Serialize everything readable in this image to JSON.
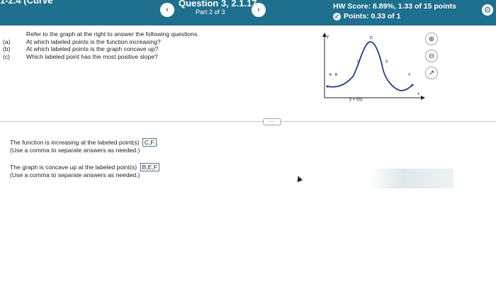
{
  "header": {
    "section_title": "1-2.4 (Curve",
    "prev_label": "‹",
    "next_label": "›",
    "question_title": "Question 3, 2.1.17",
    "question_part": "Part 2 of 3",
    "hw_score": "HW Score: 8.89%, 1.33 of 15 points",
    "points": "Points: 0.33 of 1"
  },
  "question": {
    "intro": "Refer to the graph at the right to answer the following questions.",
    "items": [
      {
        "label": "(a)",
        "text": "At which labeled points is the function increasing?"
      },
      {
        "label": "(b)",
        "text": "At which labeled points is the graph concave up?"
      },
      {
        "label": "(c)",
        "text": "Which labeled point has the most positive slope?"
      }
    ]
  },
  "graph": {
    "y_axis_label": "y",
    "x_axis_label": "x",
    "func_label": "y = f(x)",
    "points": [
      {
        "label": "A",
        "x": 0.06,
        "y": 0.3
      },
      {
        "label": "B",
        "x": 0.12,
        "y": 0.3
      },
      {
        "label": "C",
        "x": 0.34,
        "y": 0.55
      },
      {
        "label": "D",
        "x": 0.47,
        "y": 1.0
      },
      {
        "label": "E",
        "x": 0.63,
        "y": 0.55
      },
      {
        "label": "F",
        "x": 0.86,
        "y": 0.3
      }
    ]
  },
  "answers": {
    "a_prefix": "The function is increasing at the labeled point(s)",
    "a_value": "C,F",
    "a_suffix": ".",
    "a_hint": "(Use a comma to separate answers as needed.)",
    "b_prefix": "The graph is concave up at the labeled point(s)",
    "b_value": "B,E,F",
    "b_hint": "(Use a comma to separate answers as needed.)"
  },
  "more_button": "....."
}
